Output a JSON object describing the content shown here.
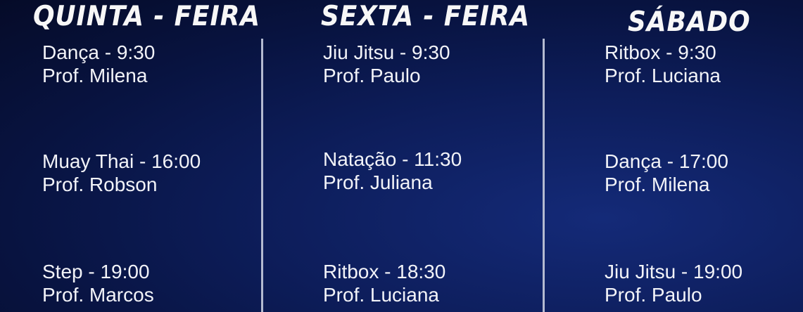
{
  "schedule": {
    "days": [
      {
        "title": "QUINTA - FEIRA",
        "classes": [
          {
            "name": "Dança - 9:30",
            "prof": "Prof. Milena"
          },
          {
            "name": "Muay Thai - 16:00",
            "prof": "Prof. Robson"
          },
          {
            "name": "Step - 19:00",
            "prof": "Prof. Marcos"
          }
        ]
      },
      {
        "title": "SEXTA - FEIRA",
        "classes": [
          {
            "name": "Jiu Jitsu - 9:30",
            "prof": "Prof. Paulo"
          },
          {
            "name": "Natação - 11:30",
            "prof": "Prof. Juliana"
          },
          {
            "name": "Ritbox - 18:30",
            "prof": "Prof. Luciana"
          }
        ]
      },
      {
        "title": "SÁBADO",
        "classes": [
          {
            "name": "Ritbox - 9:30",
            "prof": "Prof. Luciana"
          },
          {
            "name": "Dança - 17:00",
            "prof": "Prof. Milena"
          },
          {
            "name": "Jiu Jitsu - 19:00",
            "prof": "Prof. Paulo"
          }
        ]
      }
    ]
  },
  "colors": {
    "background": "#0b1850",
    "text": "#f4f5fb",
    "divider": "#b4bad0"
  }
}
